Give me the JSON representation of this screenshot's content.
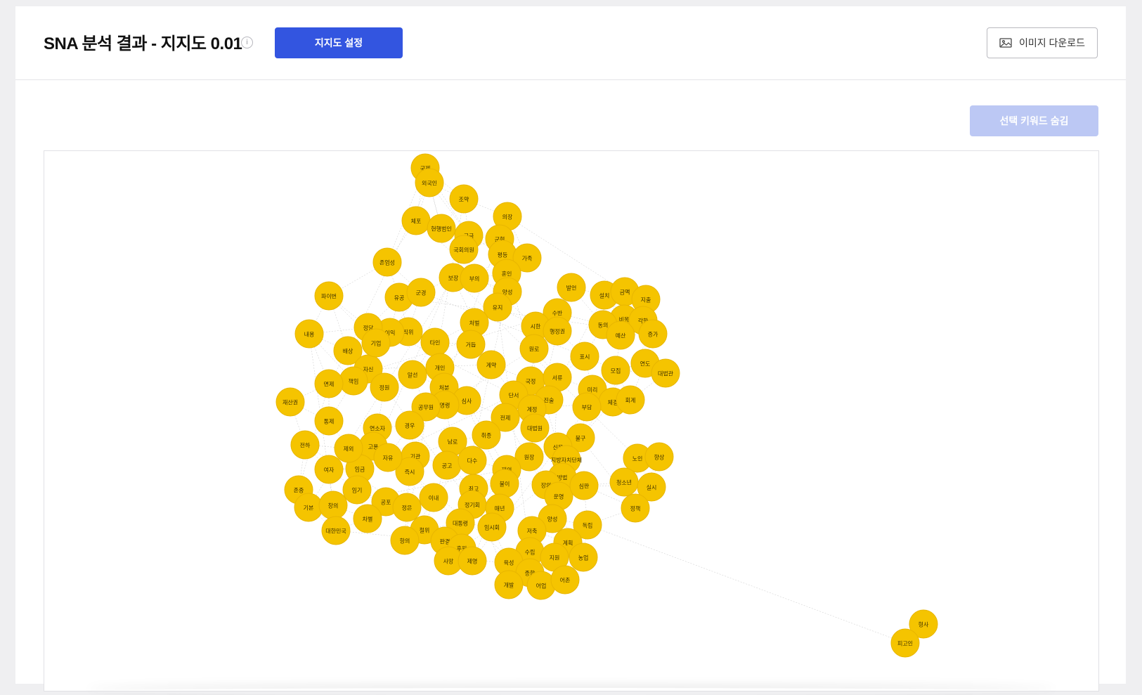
{
  "header": {
    "title": "SNA 분석 결과 - 지지도 0.01",
    "info_icon": "info-icon",
    "settings_button": "지지도 설정",
    "download_button": "이미지 다운로드",
    "download_icon": "image-icon"
  },
  "toolbar": {
    "hide_button": "선택 키워드 숨김"
  },
  "colors": {
    "primary": "#3355e0",
    "hide_button_disabled": "#bcc8f4",
    "node_fill": "#f5c400"
  },
  "graph": {
    "nodes": [
      {
        "label": "국제"
      },
      {
        "label": "외국인"
      },
      {
        "label": "조약"
      },
      {
        "label": "체포"
      },
      {
        "label": "현행범인"
      },
      {
        "label": "구금"
      },
      {
        "label": "의장"
      },
      {
        "label": "국회의원"
      },
      {
        "label": "군형"
      },
      {
        "label": "평등"
      },
      {
        "label": "가족"
      },
      {
        "label": "존엄성"
      },
      {
        "label": "보장"
      },
      {
        "label": "부의"
      },
      {
        "label": "혼인"
      },
      {
        "label": "양성"
      },
      {
        "label": "발언"
      },
      {
        "label": "설치"
      },
      {
        "label": "금액"
      },
      {
        "label": "지출"
      },
      {
        "label": "파이번"
      },
      {
        "label": "유공"
      },
      {
        "label": "군경"
      },
      {
        "label": "유지"
      },
      {
        "label": "수반"
      },
      {
        "label": "비목"
      },
      {
        "label": "각항"
      },
      {
        "label": "증가"
      },
      {
        "label": "내용"
      },
      {
        "label": "직위"
      },
      {
        "label": "타인"
      },
      {
        "label": "처벌"
      },
      {
        "label": "시한"
      },
      {
        "label": "행정권"
      },
      {
        "label": "동의"
      },
      {
        "label": "예산"
      },
      {
        "label": "배상"
      },
      {
        "label": "거듭"
      },
      {
        "label": "원로"
      },
      {
        "label": "표시"
      },
      {
        "label": "연도"
      },
      {
        "label": "대법관"
      },
      {
        "label": "자신"
      },
      {
        "label": "계약"
      },
      {
        "label": "모집"
      },
      {
        "label": "책임"
      },
      {
        "label": "알선"
      },
      {
        "label": "개인"
      },
      {
        "label": "면제"
      },
      {
        "label": "정원"
      },
      {
        "label": "국정"
      },
      {
        "label": "서류"
      },
      {
        "label": "미리"
      },
      {
        "label": "처분"
      },
      {
        "label": "단서"
      },
      {
        "label": "재산권"
      },
      {
        "label": "심사"
      },
      {
        "label": "진술"
      },
      {
        "label": "체결"
      },
      {
        "label": "회계"
      },
      {
        "label": "명령"
      },
      {
        "label": "공무원"
      },
      {
        "label": "부담"
      },
      {
        "label": "계정"
      },
      {
        "label": "통제"
      },
      {
        "label": "전제"
      },
      {
        "label": "연소자"
      },
      {
        "label": "경우"
      },
      {
        "label": "대법원"
      },
      {
        "label": "불구"
      },
      {
        "label": "전하"
      },
      {
        "label": "고용"
      },
      {
        "label": "남로"
      },
      {
        "label": "취종"
      },
      {
        "label": "신문"
      },
      {
        "label": "노인"
      },
      {
        "label": "향상"
      },
      {
        "label": "기관"
      },
      {
        "label": "원장"
      },
      {
        "label": "지방자치단체"
      },
      {
        "label": "여자"
      },
      {
        "label": "임금"
      },
      {
        "label": "공고"
      },
      {
        "label": "다수"
      },
      {
        "label": "청소년"
      },
      {
        "label": "존중"
      },
      {
        "label": "즉시"
      },
      {
        "label": "재의"
      },
      {
        "label": "방법"
      },
      {
        "label": "실시"
      },
      {
        "label": "불이"
      },
      {
        "label": "장의"
      },
      {
        "label": "최고"
      },
      {
        "label": "임기"
      },
      {
        "label": "운영"
      },
      {
        "label": "기본"
      },
      {
        "label": "창의"
      },
      {
        "label": "공포"
      },
      {
        "label": "이내"
      },
      {
        "label": "정기회"
      },
      {
        "label": "매년"
      },
      {
        "label": "정책"
      },
      {
        "label": "정은"
      },
      {
        "label": "차별"
      },
      {
        "label": "대통령"
      },
      {
        "label": "임시회"
      },
      {
        "label": "양성"
      },
      {
        "label": "독립"
      },
      {
        "label": "대한민국"
      },
      {
        "label": "철위"
      },
      {
        "label": "저축"
      },
      {
        "label": "항의"
      },
      {
        "label": "판결"
      },
      {
        "label": "후원"
      },
      {
        "label": "수립"
      },
      {
        "label": "계획"
      },
      {
        "label": "사망"
      },
      {
        "label": "제영"
      },
      {
        "label": "육성"
      },
      {
        "label": "지원"
      },
      {
        "label": "농업"
      },
      {
        "label": "종합"
      },
      {
        "label": "개발"
      },
      {
        "label": "어업"
      },
      {
        "label": "어촌"
      },
      {
        "label": "형사"
      },
      {
        "label": "피고인"
      },
      {
        "label": "이익"
      },
      {
        "label": "정당"
      },
      {
        "label": "기업"
      },
      {
        "label": "제외"
      },
      {
        "label": "자유"
      },
      {
        "label": "심판"
      }
    ]
  }
}
